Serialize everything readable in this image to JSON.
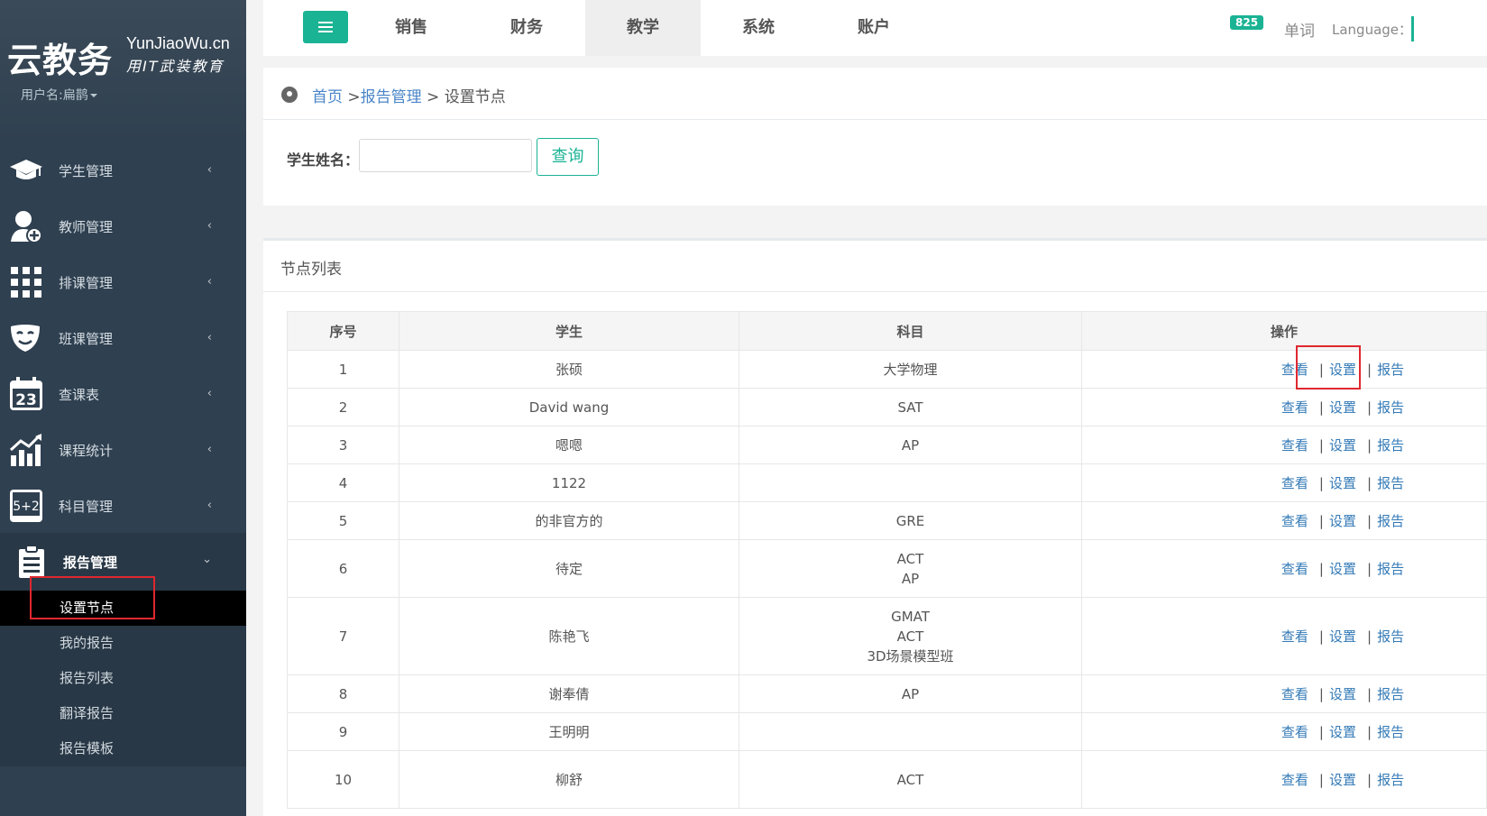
{
  "sidebar": {
    "logo_main": "云教务",
    "logo_en": "YunJiaoWu.cn",
    "logo_slogan": "用IT武装教育",
    "user": "用户名:扁鹊",
    "items": [
      {
        "label": "学生管理",
        "icon": "graduation-cap-icon"
      },
      {
        "label": "教师管理",
        "icon": "teacher-add-icon"
      },
      {
        "label": "排课管理",
        "icon": "grid-icon"
      },
      {
        "label": "班课管理",
        "icon": "theater-masks-icon"
      },
      {
        "label": "查课表",
        "icon": "calendar-icon"
      },
      {
        "label": "课程统计",
        "icon": "bar-chart-icon"
      },
      {
        "label": "科目管理",
        "icon": "formula-board-icon"
      },
      {
        "label": "报告管理",
        "icon": "clipboard-icon"
      }
    ],
    "calendar_day": "23",
    "formula_text": "5+2",
    "submenu": [
      "设置节点",
      "我的报告",
      "报告列表",
      "翻译报告",
      "报告模板"
    ]
  },
  "topnav": {
    "tabs": [
      "销售",
      "财务",
      "教学",
      "系统",
      "账户"
    ],
    "active_tab": "教学",
    "badge": "825",
    "word_link": "单词",
    "language": "Language："
  },
  "breadcrumb": {
    "home": "首页",
    "sep1": " >",
    "section": "报告管理",
    "sep2": " > ",
    "current": "设置节点"
  },
  "search": {
    "label": "学生姓名：",
    "value": "",
    "button": "查询"
  },
  "list": {
    "title": "节点列表",
    "headers": [
      "序号",
      "学生",
      "科目",
      "操作"
    ],
    "ops": [
      "查看",
      "设置",
      "报告"
    ],
    "op_sep": "|",
    "rows": [
      {
        "no": "1",
        "student": "张硕",
        "subjects": [
          "大学物理"
        ]
      },
      {
        "no": "2",
        "student": "David wang",
        "subjects": [
          "SAT"
        ]
      },
      {
        "no": "3",
        "student": "嗯嗯",
        "subjects": [
          "AP"
        ]
      },
      {
        "no": "4",
        "student": "1122",
        "subjects": []
      },
      {
        "no": "5",
        "student": "的非官方的",
        "subjects": [
          "GRE"
        ]
      },
      {
        "no": "6",
        "student": "待定",
        "subjects": [
          "ACT",
          "AP"
        ]
      },
      {
        "no": "7",
        "student": "陈艳飞",
        "subjects": [
          "GMAT",
          "ACT",
          "3D场景模型班"
        ]
      },
      {
        "no": "8",
        "student": "谢奉倩",
        "subjects": [
          "AP"
        ]
      },
      {
        "no": "9",
        "student": "王明明",
        "subjects": []
      },
      {
        "no": "10",
        "student": "柳舒",
        "subjects": [
          "ACT"
        ]
      }
    ]
  },
  "colors": {
    "accent": "#1ab394",
    "sidebar": "#2f4050",
    "link": "#337ab7",
    "highlight": "#e0272f"
  }
}
